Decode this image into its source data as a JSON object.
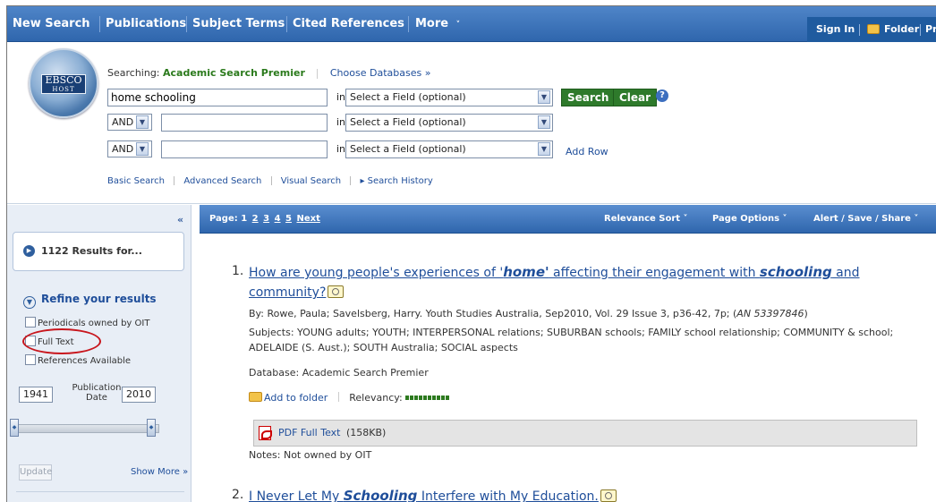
{
  "nav": {
    "items": [
      "New Search",
      "Publications",
      "Subject Terms",
      "Cited References",
      "More"
    ],
    "right": [
      "Sign In",
      "Folder",
      "Pref"
    ]
  },
  "search": {
    "logo": {
      "line1": "EBSCO",
      "line2": "HOST"
    },
    "searching_label": "Searching:",
    "database": "Academic Search Premier",
    "choose_databases": "Choose Databases »",
    "rows": [
      {
        "bool": "",
        "value": "home schooling",
        "field": "Select a Field (optional)"
      },
      {
        "bool": "AND",
        "value": "",
        "field": "Select a Field (optional)"
      },
      {
        "bool": "AND",
        "value": "",
        "field": "Select a Field (optional)"
      }
    ],
    "in_label": "in",
    "search_button": "Search",
    "clear_button": "Clear",
    "help": "?",
    "add_row": "Add Row",
    "links": [
      "Basic Search",
      "Advanced Search",
      "Visual Search",
      "▸ Search History"
    ]
  },
  "sidebar": {
    "collapse": "«",
    "results_text": "1122 Results for...",
    "refine_title": "Refine your results",
    "checkboxes": [
      "Periodicals owned by OIT",
      "Full Text",
      "References Available"
    ],
    "year_from": "1941",
    "year_to": "2010",
    "publication_date_label": "Publication Date",
    "update_button": "Update",
    "show_more": "Show More »"
  },
  "results_bar": {
    "page_label": "Page: 1",
    "pages": [
      "2",
      "3",
      "4",
      "5",
      "Next"
    ],
    "relevance_sort": "Relevance Sort ˅",
    "page_options": "Page Options ˅",
    "alert_save_share": "Alert / Save / Share ˅"
  },
  "results": [
    {
      "num": "1.",
      "title_parts": [
        "How are young people's experiences of '",
        "home'",
        " affecting their engagement with ",
        "schooling",
        " and",
        "community?"
      ],
      "byline": "By: Rowe, Paula; Savelsberg, Harry. Youth Studies Australia, Sep2010, Vol. 29 Issue 3, p36-42, 7p; (",
      "an": "AN 53397846",
      "byline_end": ")",
      "subjects_line1": "Subjects: YOUNG adults; YOUTH; INTERPERSONAL relations; SUBURBAN schools; FAMILY school relationship; COMMUNITY & school;",
      "subjects_line2": "ADELAIDE (S. Aust.); SOUTH Australia; SOCIAL aspects",
      "database_line": "Database: Academic Search Premier",
      "add_to_folder": "Add to folder",
      "relevancy_label": "Relevancy:",
      "pdf": "PDF Full Text",
      "pdf_size": "(158KB)",
      "notes": "Notes:  Not owned by OIT"
    },
    {
      "num": "2.",
      "title_parts": [
        "I Never Let My ",
        "Schooling",
        " Interfere with My Education."
      ]
    }
  ]
}
